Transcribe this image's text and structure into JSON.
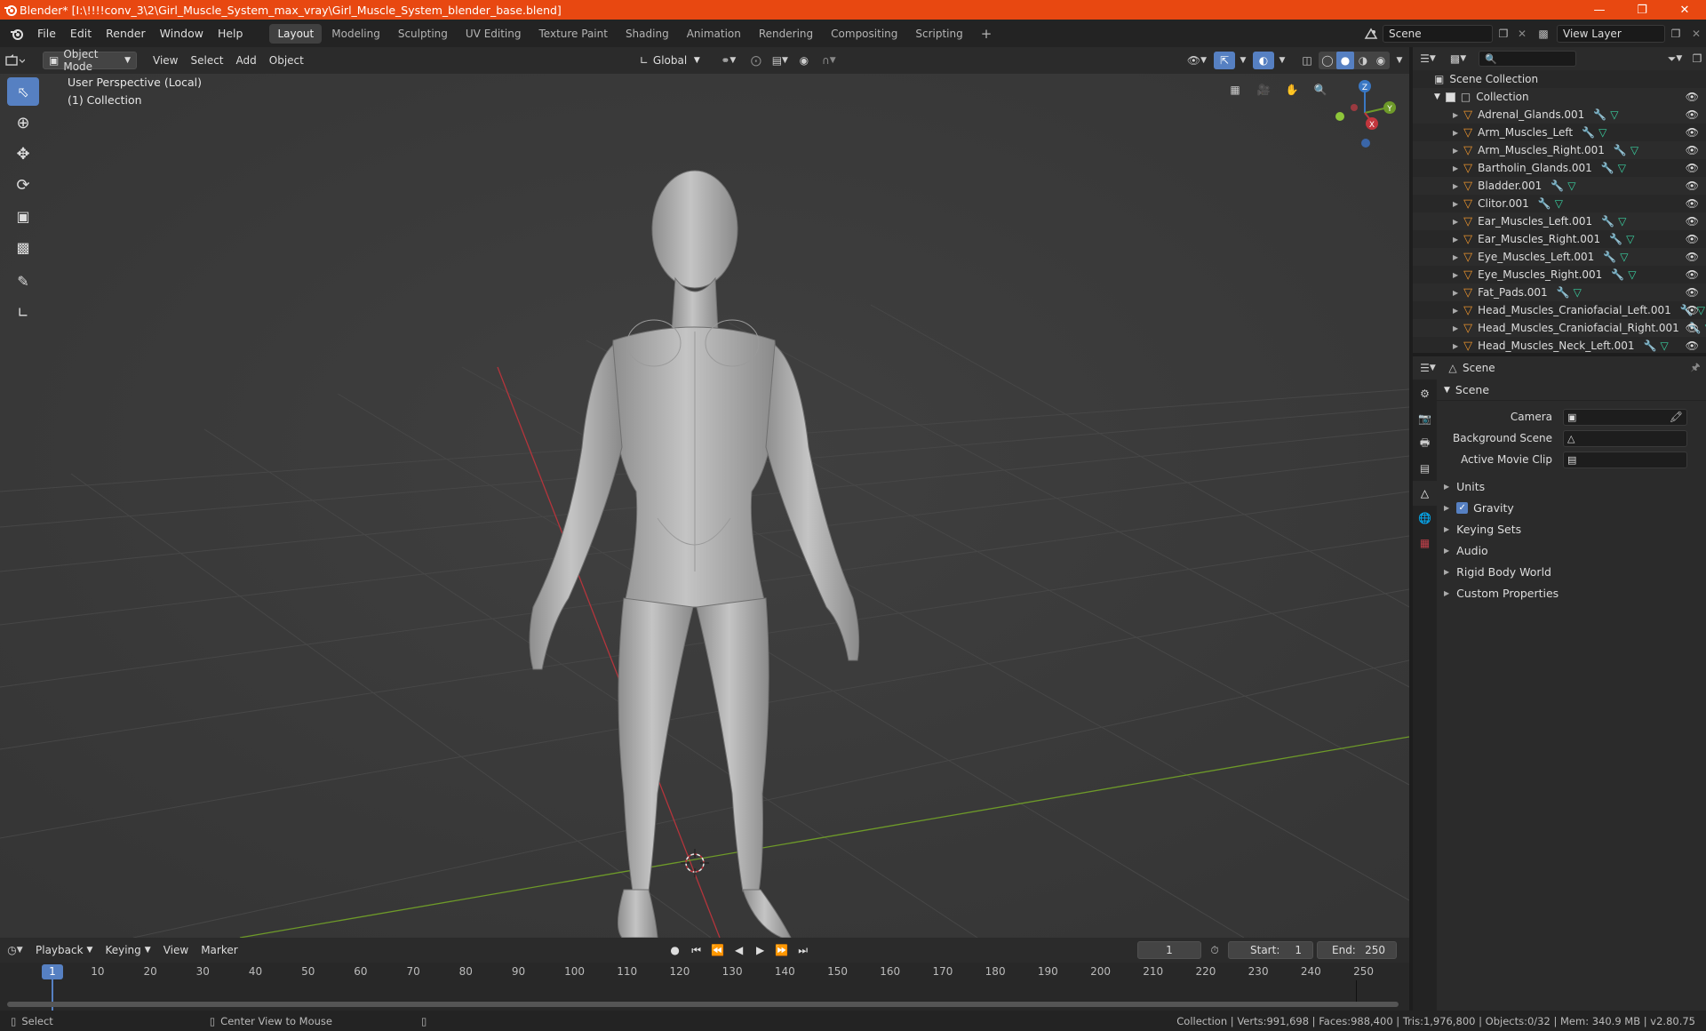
{
  "window": {
    "title": "Blender* [I:\\!!!!conv_3\\2\\Girl_Muscle_System_max_vray\\Girl_Muscle_System_blender_base.blend]",
    "accent": "#e84811"
  },
  "menu": [
    "File",
    "Edit",
    "Render",
    "Window",
    "Help"
  ],
  "workspaces": {
    "tabs": [
      "Layout",
      "Modeling",
      "Sculpting",
      "UV Editing",
      "Texture Paint",
      "Shading",
      "Animation",
      "Rendering",
      "Compositing",
      "Scripting"
    ],
    "active": "Layout",
    "add_label": "+"
  },
  "scene_selector": {
    "value": "Scene"
  },
  "view_layer": {
    "value": "View Layer"
  },
  "viewport_header": {
    "mode": "Object Mode",
    "menus": [
      "View",
      "Select",
      "Add",
      "Object"
    ],
    "orientation": "Global"
  },
  "viewport": {
    "perspective": "User Perspective (Local)",
    "collection": "(1) Collection",
    "gizmo": {
      "z": "Z",
      "y": "Y",
      "x": "X"
    }
  },
  "outliner": {
    "search_placeholder": "",
    "root": "Scene Collection",
    "collection": "Collection",
    "items": [
      "Adrenal_Glands.001",
      "Arm_Muscles_Left",
      "Arm_Muscles_Right.001",
      "Bartholin_Glands.001",
      "Bladder.001",
      "Clitor.001",
      "Ear_Muscles_Left.001",
      "Ear_Muscles_Right.001",
      "Eye_Muscles_Left.001",
      "Eye_Muscles_Right.001",
      "Fat_Pads.001",
      "Head_Muscles_Craniofacial_Left.001",
      "Head_Muscles_Craniofacial_Right.001",
      "Head_Muscles_Neck_Left.001"
    ]
  },
  "properties": {
    "header": "Scene",
    "panel": "Scene",
    "camera_label": "Camera",
    "background_label": "Background Scene",
    "clip_label": "Active Movie Clip",
    "sections": [
      "Units",
      "Gravity",
      "Keying Sets",
      "Audio",
      "Rigid Body World",
      "Custom Properties"
    ]
  },
  "timeline": {
    "menus": [
      "Playback",
      "Keying",
      "View",
      "Marker"
    ],
    "current_frame": "1",
    "start_label": "Start:",
    "start": "1",
    "end_label": "End:",
    "end": "250",
    "ticks": [
      "10",
      "20",
      "30",
      "40",
      "50",
      "60",
      "70",
      "80",
      "90",
      "100",
      "110",
      "120",
      "130",
      "140",
      "150",
      "160",
      "170",
      "180",
      "190",
      "200",
      "210",
      "220",
      "230",
      "240",
      "250"
    ]
  },
  "status": {
    "left": "Select",
    "mid": "Center View to Mouse",
    "right": "Collection | Verts:991,698 | Faces:988,400 | Tris:1,976,800 | Objects:0/32 | Mem: 340.9 MB | v2.80.75"
  },
  "colors": {
    "x_axis": "#c2363d",
    "y_axis": "#6e9a29",
    "z_axis": "#3a78c4",
    "select_blue": "#5680c2",
    "mesh_orange": "#e8922d"
  }
}
